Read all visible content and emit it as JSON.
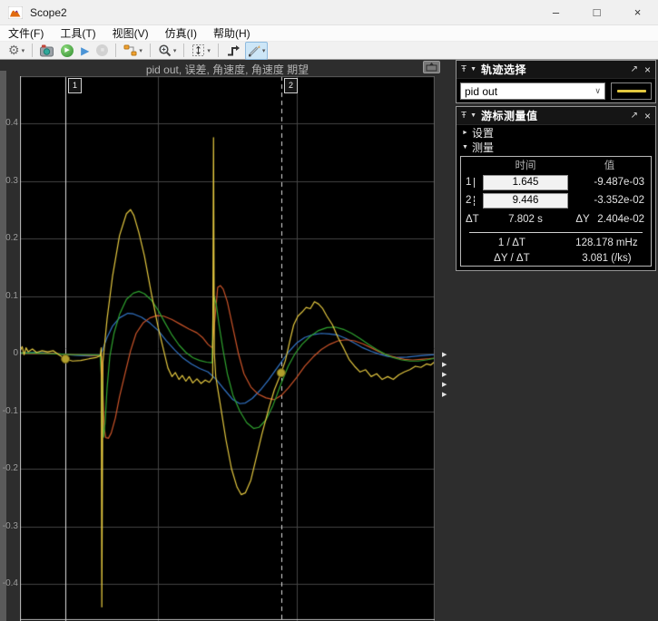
{
  "window": {
    "title": "Scope2",
    "controls": [
      {
        "name": "minimize",
        "glyph": "–"
      },
      {
        "name": "maximize",
        "glyph": "□"
      },
      {
        "name": "close",
        "glyph": "×"
      }
    ]
  },
  "menubar": {
    "items": [
      "文件(F)",
      "工具(T)",
      "视图(V)",
      "仿真(I)",
      "帮助(H)"
    ]
  },
  "toolbar": {
    "caret": "▾",
    "buttons": [
      {
        "name": "settings",
        "glyph": "⚙",
        "dropdown": true,
        "sep_after": true
      },
      {
        "name": "snapshot",
        "svg": "cam"
      },
      {
        "name": "run",
        "glyph": "▶",
        "style": "run"
      },
      {
        "name": "step-forward",
        "glyph": "▶",
        "style": "step"
      },
      {
        "name": "stop",
        "glyph": "■",
        "style": "stop",
        "disabled": true,
        "sep_after": true
      },
      {
        "name": "signal-selector",
        "svg": "sel",
        "dropdown": true,
        "sep_after": true
      },
      {
        "name": "zoom",
        "svg": "mag",
        "dropdown": true,
        "sep_after": true
      },
      {
        "name": "fit-to-view",
        "svg": "fit",
        "dropdown": true,
        "sep_after": true
      },
      {
        "name": "trigger",
        "svg": "trig"
      },
      {
        "name": "cursor-measurements",
        "svg": "pencil",
        "active": true,
        "dropdown": true
      }
    ]
  },
  "content": {
    "expander_arrow": "▶",
    "expander_count": 5
  },
  "panels": {
    "trace": {
      "title": "轨迹选择",
      "pin": "Ŧ",
      "collapse": "▼",
      "undock": "↗",
      "close": "×",
      "combo_value": "pid out",
      "combo_caret": "∨",
      "swatch_color": "#e3c73f"
    },
    "cursor": {
      "title": "游标测量值",
      "pin": "Ŧ",
      "collapse": "▼",
      "undock": "↗",
      "close": "×",
      "settings_arrow": "►",
      "settings_label": "设置",
      "measure_arrow": "▼",
      "measure_label": "测量",
      "table": {
        "time_header": "时间",
        "value_header": "值",
        "rows": [
          {
            "id": "1",
            "time": "1.645",
            "value": "-9.487e-03"
          },
          {
            "id": "2",
            "time": "9.446",
            "value": "-3.352e-02"
          }
        ],
        "dt_label": "ΔT",
        "dt_value": "7.802 s",
        "dy_label": "ΔY",
        "dy_value": "2.404e-02",
        "freq_label": "1 / ΔT",
        "freq_value": "128.178 mHz",
        "slope_label": "ΔY / ΔT",
        "slope_value": "3.081 (/ks)"
      }
    }
  },
  "chart_data": {
    "type": "line",
    "title": "pid out, 误差, 角速度, 角速度 期望",
    "xlabel": "",
    "ylabel": "",
    "xlim": [
      0,
      15
    ],
    "ylim": [
      -0.465,
      0.48
    ],
    "xticks": [
      5,
      10
    ],
    "yticks": [
      0.4,
      0.3,
      0.2,
      0.1,
      0,
      -0.1,
      -0.2,
      -0.3,
      -0.4
    ],
    "ytick_labels": [
      "0.4",
      "0.3",
      "0.2",
      "0.1",
      "0",
      "-0.1",
      "-0.2",
      "-0.3",
      "-0.4"
    ],
    "grid": true,
    "background": "#000000",
    "grid_color": "#454545",
    "cursors": [
      {
        "id": "1",
        "t": 1.645,
        "y": -0.009487,
        "style": "solid"
      },
      {
        "id": "2",
        "t": 9.446,
        "y": -0.03352,
        "style": "dashed"
      }
    ],
    "marker_color": "#b2a02c",
    "series": [
      {
        "name": "pid out",
        "color": "#e3c73f",
        "points": [
          [
            0,
            0.004
          ],
          [
            0.08,
            0.012
          ],
          [
            0.15,
            -0.002
          ],
          [
            0.22,
            0.01
          ],
          [
            0.3,
            0.003
          ],
          [
            0.45,
            0.008
          ],
          [
            0.6,
            0.002
          ],
          [
            0.8,
            0.005
          ],
          [
            1,
            0.003
          ],
          [
            1.2,
            0.005
          ],
          [
            1.4,
            -0.002
          ],
          [
            1.645,
            -0.0095
          ],
          [
            1.9,
            -0.013
          ],
          [
            2.2,
            -0.012
          ],
          [
            2.5,
            -0.009
          ],
          [
            2.75,
            -0.007
          ],
          [
            2.9,
            -0.004
          ],
          [
            2.94,
            0.01
          ],
          [
            2.96,
            -0.44
          ],
          [
            3,
            -0.015
          ],
          [
            3.15,
            0.06
          ],
          [
            3.35,
            0.135
          ],
          [
            3.6,
            0.205
          ],
          [
            3.85,
            0.243
          ],
          [
            4,
            0.25
          ],
          [
            4.12,
            0.24
          ],
          [
            4.3,
            0.21
          ],
          [
            4.5,
            0.17
          ],
          [
            4.75,
            0.105
          ],
          [
            5,
            0.045
          ],
          [
            5.2,
            0.005
          ],
          [
            5.35,
            -0.025
          ],
          [
            5.5,
            -0.04
          ],
          [
            5.62,
            -0.033
          ],
          [
            5.75,
            -0.045
          ],
          [
            5.87,
            -0.038
          ],
          [
            6,
            -0.048
          ],
          [
            6.12,
            -0.04
          ],
          [
            6.25,
            -0.051
          ],
          [
            6.4,
            -0.044
          ],
          [
            6.55,
            -0.052
          ],
          [
            6.7,
            -0.046
          ],
          [
            6.85,
            -0.05
          ],
          [
            6.97,
            -0.042
          ],
          [
            7,
            0.375
          ],
          [
            7.03,
            0
          ],
          [
            7.08,
            -0.04
          ],
          [
            7.25,
            -0.09
          ],
          [
            7.45,
            -0.15
          ],
          [
            7.65,
            -0.2
          ],
          [
            7.85,
            -0.232
          ],
          [
            8,
            -0.245
          ],
          [
            8.15,
            -0.242
          ],
          [
            8.35,
            -0.22
          ],
          [
            8.55,
            -0.18
          ],
          [
            8.75,
            -0.14
          ],
          [
            9,
            -0.095
          ],
          [
            9.2,
            -0.063
          ],
          [
            9.446,
            -0.0335
          ],
          [
            9.6,
            -0.012
          ],
          [
            9.75,
            0.02
          ],
          [
            9.9,
            0.05
          ],
          [
            10.05,
            0.065
          ],
          [
            10.2,
            0.072
          ],
          [
            10.35,
            0.08
          ],
          [
            10.5,
            0.078
          ],
          [
            10.65,
            0.09
          ],
          [
            10.8,
            0.086
          ],
          [
            10.95,
            0.078
          ],
          [
            11.1,
            0.065
          ],
          [
            11.3,
            0.05
          ],
          [
            11.5,
            0.028
          ],
          [
            11.7,
            0.01
          ],
          [
            11.9,
            -0.01
          ],
          [
            12.1,
            -0.022
          ],
          [
            12.3,
            -0.032
          ],
          [
            12.5,
            -0.028
          ],
          [
            12.7,
            -0.04
          ],
          [
            12.9,
            -0.035
          ],
          [
            13.1,
            -0.045
          ],
          [
            13.3,
            -0.04
          ],
          [
            13.5,
            -0.045
          ],
          [
            13.7,
            -0.037
          ],
          [
            13.9,
            -0.032
          ],
          [
            14.1,
            -0.028
          ],
          [
            14.3,
            -0.022
          ],
          [
            14.5,
            -0.024
          ],
          [
            14.7,
            -0.018
          ],
          [
            14.85,
            -0.02
          ],
          [
            15,
            -0.014
          ]
        ]
      },
      {
        "name": "误差",
        "color": "#3274c6",
        "points": [
          [
            0,
            0.001
          ],
          [
            0.5,
            0.002
          ],
          [
            1,
            0.001
          ],
          [
            1.5,
            -0.001
          ],
          [
            2,
            -0.003
          ],
          [
            2.5,
            -0.004
          ],
          [
            2.9,
            -0.003
          ],
          [
            3,
            0.008
          ],
          [
            3.15,
            0.028
          ],
          [
            3.35,
            0.048
          ],
          [
            3.6,
            0.062
          ],
          [
            3.9,
            0.07
          ],
          [
            4.1,
            0.069
          ],
          [
            4.4,
            0.063
          ],
          [
            4.7,
            0.053
          ],
          [
            5,
            0.04
          ],
          [
            5.3,
            0.022
          ],
          [
            5.6,
            0.006
          ],
          [
            5.9,
            -0.008
          ],
          [
            6.2,
            -0.018
          ],
          [
            6.5,
            -0.026
          ],
          [
            6.8,
            -0.032
          ],
          [
            7.1,
            -0.045
          ],
          [
            7.4,
            -0.063
          ],
          [
            7.7,
            -0.08
          ],
          [
            7.95,
            -0.087
          ],
          [
            8.15,
            -0.086
          ],
          [
            8.4,
            -0.078
          ],
          [
            8.7,
            -0.063
          ],
          [
            9,
            -0.045
          ],
          [
            9.25,
            -0.028
          ],
          [
            9.446,
            -0.015
          ],
          [
            9.7,
            0.002
          ],
          [
            10,
            0.018
          ],
          [
            10.3,
            0.028
          ],
          [
            10.6,
            0.033
          ],
          [
            10.9,
            0.035
          ],
          [
            11.2,
            0.034
          ],
          [
            11.5,
            0.032
          ],
          [
            11.8,
            0.026
          ],
          [
            12.1,
            0.018
          ],
          [
            12.4,
            0.01
          ],
          [
            12.7,
            0.004
          ],
          [
            13,
            -0.001
          ],
          [
            13.3,
            -0.005
          ],
          [
            13.6,
            -0.007
          ],
          [
            14,
            -0.006
          ],
          [
            14.4,
            -0.004
          ],
          [
            14.7,
            -0.003
          ],
          [
            15,
            -0.002
          ]
        ]
      },
      {
        "name": "角速度",
        "color": "#cc5429",
        "points": [
          [
            0,
            0.001
          ],
          [
            0.5,
            0
          ],
          [
            1,
            0.001
          ],
          [
            1.5,
            -0.001
          ],
          [
            2,
            -0.002
          ],
          [
            2.5,
            -0.003
          ],
          [
            2.95,
            -0.004
          ],
          [
            3,
            -0.07
          ],
          [
            3.05,
            -0.13
          ],
          [
            3.1,
            -0.146
          ],
          [
            3.2,
            -0.147
          ],
          [
            3.3,
            -0.138
          ],
          [
            3.45,
            -0.112
          ],
          [
            3.6,
            -0.075
          ],
          [
            3.8,
            -0.035
          ],
          [
            4,
            0.005
          ],
          [
            4.2,
            0.035
          ],
          [
            4.45,
            0.053
          ],
          [
            4.7,
            0.062
          ],
          [
            4.95,
            0.066
          ],
          [
            5.2,
            0.065
          ],
          [
            5.5,
            0.059
          ],
          [
            5.8,
            0.051
          ],
          [
            6.1,
            0.043
          ],
          [
            6.4,
            0.036
          ],
          [
            6.6,
            0.028
          ],
          [
            6.8,
            0.016
          ],
          [
            6.95,
            0.01
          ],
          [
            7.05,
            0.06
          ],
          [
            7.15,
            0.115
          ],
          [
            7.25,
            0.118
          ],
          [
            7.35,
            0.112
          ],
          [
            7.5,
            0.09
          ],
          [
            7.7,
            0.045
          ],
          [
            7.9,
            0
          ],
          [
            8.1,
            -0.035
          ],
          [
            8.35,
            -0.058
          ],
          [
            8.6,
            -0.07
          ],
          [
            8.9,
            -0.077
          ],
          [
            9.2,
            -0.08
          ],
          [
            9.446,
            -0.073
          ],
          [
            9.7,
            -0.06
          ],
          [
            10,
            -0.042
          ],
          [
            10.3,
            -0.022
          ],
          [
            10.6,
            -0.006
          ],
          [
            10.9,
            0.007
          ],
          [
            11.2,
            0.016
          ],
          [
            11.5,
            0.022
          ],
          [
            11.8,
            0.024
          ],
          [
            12.1,
            0.022
          ],
          [
            12.4,
            0.017
          ],
          [
            12.7,
            0.01
          ],
          [
            13,
            0.003
          ],
          [
            13.3,
            -0.003
          ],
          [
            13.6,
            -0.007
          ],
          [
            13.9,
            -0.01
          ],
          [
            14.2,
            -0.011
          ],
          [
            14.5,
            -0.01
          ],
          [
            14.8,
            -0.009
          ],
          [
            15,
            -0.008
          ]
        ]
      },
      {
        "name": "角速度 期望",
        "color": "#2fa32f",
        "points": [
          [
            0,
            0.001
          ],
          [
            0.5,
            0.001
          ],
          [
            1,
            0
          ],
          [
            1.5,
            -0.001
          ],
          [
            2,
            -0.002
          ],
          [
            2.5,
            -0.002
          ],
          [
            2.9,
            -0.003
          ],
          [
            2.97,
            -0.06
          ],
          [
            3,
            -0.125
          ],
          [
            3.03,
            -0.145
          ],
          [
            3.08,
            -0.118
          ],
          [
            3.15,
            -0.06
          ],
          [
            3.25,
            -0.005
          ],
          [
            3.4,
            0.035
          ],
          [
            3.6,
            0.068
          ],
          [
            3.85,
            0.094
          ],
          [
            4.1,
            0.105
          ],
          [
            4.3,
            0.108
          ],
          [
            4.5,
            0.104
          ],
          [
            4.75,
            0.093
          ],
          [
            5,
            0.075
          ],
          [
            5.25,
            0.053
          ],
          [
            5.5,
            0.032
          ],
          [
            5.75,
            0.015
          ],
          [
            6,
            0.002
          ],
          [
            6.25,
            -0.007
          ],
          [
            6.5,
            -0.012
          ],
          [
            6.75,
            -0.015
          ],
          [
            6.95,
            -0.016
          ],
          [
            6.98,
            0.07
          ],
          [
            7.02,
            0.1
          ],
          [
            7.1,
            0.085
          ],
          [
            7.2,
            0.05
          ],
          [
            7.35,
            0.005
          ],
          [
            7.5,
            -0.035
          ],
          [
            7.7,
            -0.072
          ],
          [
            7.95,
            -0.1
          ],
          [
            8.2,
            -0.12
          ],
          [
            8.45,
            -0.13
          ],
          [
            8.65,
            -0.128
          ],
          [
            8.9,
            -0.115
          ],
          [
            9.15,
            -0.09
          ],
          [
            9.446,
            -0.052
          ],
          [
            9.7,
            -0.022
          ],
          [
            9.95,
            0
          ],
          [
            10.2,
            0.016
          ],
          [
            10.5,
            0.03
          ],
          [
            10.8,
            0.04
          ],
          [
            11.1,
            0.045
          ],
          [
            11.4,
            0.046
          ],
          [
            11.7,
            0.042
          ],
          [
            12,
            0.035
          ],
          [
            12.3,
            0.026
          ],
          [
            12.6,
            0.016
          ],
          [
            12.9,
            0.007
          ],
          [
            13.2,
            -0.001
          ],
          [
            13.5,
            -0.007
          ],
          [
            13.8,
            -0.011
          ],
          [
            14.1,
            -0.013
          ],
          [
            14.4,
            -0.013
          ],
          [
            14.7,
            -0.011
          ],
          [
            15,
            -0.008
          ]
        ]
      }
    ]
  }
}
